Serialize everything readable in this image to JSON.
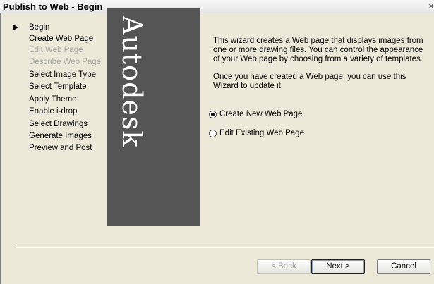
{
  "window": {
    "title": "Publish to Web - Begin",
    "close_glyph": "✕"
  },
  "steps": [
    {
      "label": "Begin",
      "state": "current"
    },
    {
      "label": "Create Web Page",
      "state": "enabled"
    },
    {
      "label": "Edit Web Page",
      "state": "disabled"
    },
    {
      "label": "Describe Web Page",
      "state": "disabled"
    },
    {
      "label": "Select Image Type",
      "state": "enabled"
    },
    {
      "label": "Select Template",
      "state": "enabled"
    },
    {
      "label": "Apply Theme",
      "state": "enabled"
    },
    {
      "label": "Enable i-drop",
      "state": "enabled"
    },
    {
      "label": "Select Drawings",
      "state": "enabled"
    },
    {
      "label": "Generate Images",
      "state": "enabled"
    },
    {
      "label": "Preview and Post",
      "state": "enabled"
    }
  ],
  "brand": {
    "logo_text": "Autodesk"
  },
  "intro": {
    "paragraph1": "This wizard creates a Web page that displays images from one or more drawing files. You can control the appearance of your Web page by choosing from a variety of templates.",
    "paragraph2": "Once you have created a Web page, you can use this Wizard to update it."
  },
  "options": [
    {
      "label": "Create New Web Page",
      "checked": true
    },
    {
      "label": "Edit Existing Web Page",
      "checked": false
    }
  ],
  "buttons": {
    "back": "< Back",
    "next": "Next >",
    "cancel": "Cancel"
  }
}
